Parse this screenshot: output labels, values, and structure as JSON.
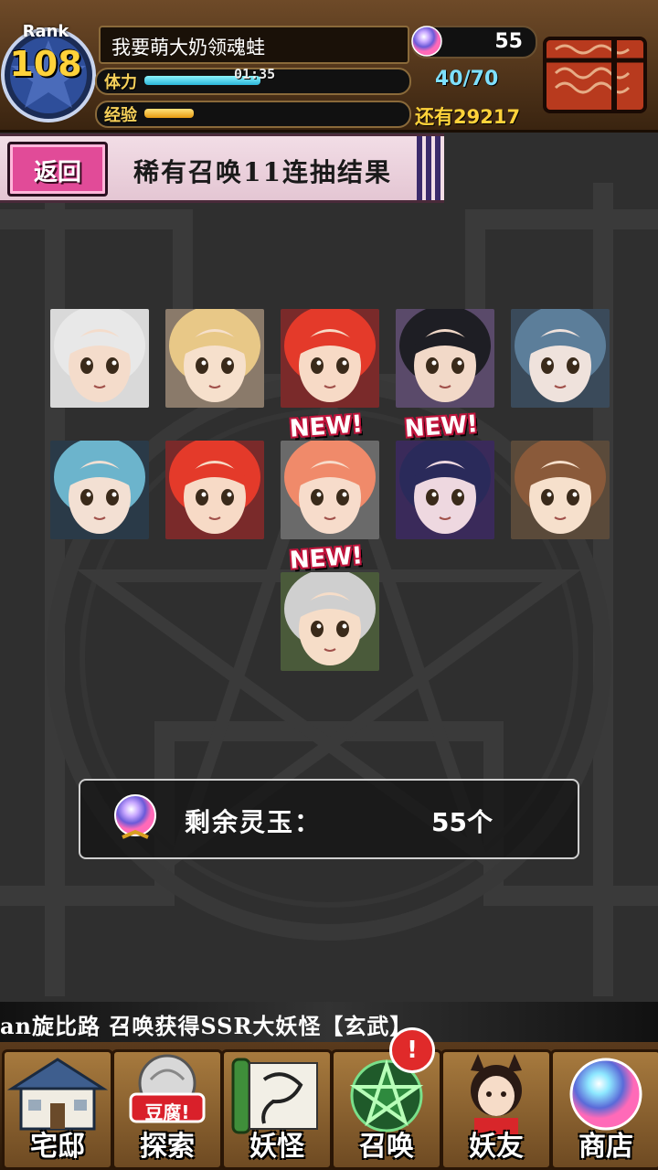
{
  "header": {
    "rank_word": "Rank",
    "rank_level": "108",
    "player_name": "我要萌大奶领魂蛙",
    "stamina_label": "体力",
    "stamina_timer": "01:35",
    "stamina_fill": 0.47,
    "exp_label": "经验",
    "exp_fill": 0.2,
    "orb_count": "55",
    "stamina_count": "40/70",
    "exp_remaining": "还有29217",
    "icons": [
      "rank-star-icon",
      "spirit-orb-icon",
      "treasure-chest-icon"
    ]
  },
  "title_bar": {
    "back_label": "返回",
    "title": "稀有召唤11连抽结果"
  },
  "results": {
    "cards": [
      {
        "name": "white-hood-girl",
        "new": false,
        "hair": "#e8e8e8",
        "skin": "#f4dccb",
        "bg": "#d9d9d9"
      },
      {
        "name": "blonde-elf-girl",
        "new": false,
        "hair": "#e8c887",
        "skin": "#f6e0cc",
        "bg": "#8a7a6a"
      },
      {
        "name": "red-hair-girl",
        "new": false,
        "hair": "#e43a2a",
        "skin": "#f7dac6",
        "bg": "#7a2a2a"
      },
      {
        "name": "black-hair-girl",
        "new": false,
        "hair": "#1e1e24",
        "skin": "#f2d9c8",
        "bg": "#5a4a6a"
      },
      {
        "name": "blue-hair-boy",
        "new": false,
        "hair": "#5c7e9a",
        "skin": "#efe2dc",
        "bg": "#3a4a5a"
      },
      {
        "name": "teal-hair-headphones",
        "new": false,
        "hair": "#6cb4cc",
        "skin": "#f3e0d3",
        "bg": "#2a3a48"
      },
      {
        "name": "red-hair-girl-2",
        "new": false,
        "hair": "#e43a2a",
        "skin": "#f7dac6",
        "bg": "#7a2a2a"
      },
      {
        "name": "pink-fox-boy",
        "new": true,
        "hair": "#f08a6a",
        "skin": "#f7dccb",
        "bg": "#6a6a6a"
      },
      {
        "name": "dark-purple-girl",
        "new": true,
        "hair": "#2a2a5a",
        "skin": "#eed8e0",
        "bg": "#3a2a5a"
      },
      {
        "name": "brown-hair-girl",
        "new": false,
        "hair": "#8a5a3a",
        "skin": "#f6e0cc",
        "bg": "#5a4a3a"
      },
      {
        "name": "silver-hair-girl",
        "new": true,
        "hair": "#cfcfcf",
        "skin": "#f6ddc8",
        "bg": "#4a5a3a"
      }
    ],
    "new_label": "NEW!"
  },
  "remaining": {
    "label": "剩余灵玉：",
    "value": "55个"
  },
  "ticker": {
    "text": "an旋比路 召唤获得SSR大妖怪【玄武】"
  },
  "nav": [
    {
      "label": "宅邸",
      "icon": "mansion-icon"
    },
    {
      "label": "探索",
      "icon": "tofu-explore-icon",
      "tag": "豆腐!"
    },
    {
      "label": "妖怪",
      "icon": "scroll-yokai-icon"
    },
    {
      "label": "召唤",
      "icon": "pentagram-summon-icon"
    },
    {
      "label": "妖友",
      "icon": "fox-girl-friend-icon"
    },
    {
      "label": "商店",
      "icon": "crystal-orb-shop-icon"
    }
  ],
  "alert_badge": "!"
}
